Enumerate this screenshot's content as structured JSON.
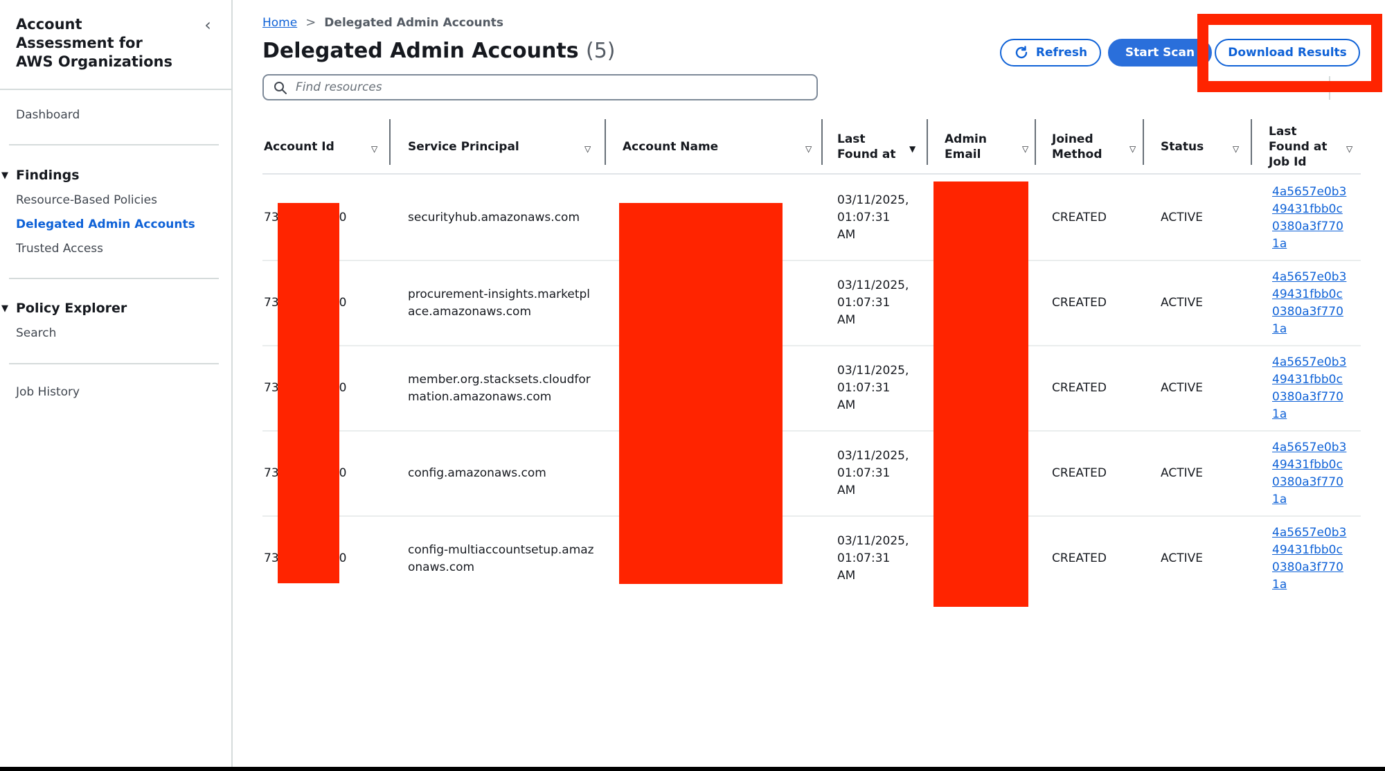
{
  "sidebar": {
    "title": "Account Assessment for AWS Organizations",
    "collapse_icon": "chevron-left-icon",
    "dashboard": "Dashboard",
    "sections": [
      {
        "label": "Findings",
        "expanded": true,
        "items": [
          {
            "label": "Resource-Based Policies",
            "active": false
          },
          {
            "label": "Delegated Admin Accounts",
            "active": true
          },
          {
            "label": "Trusted Access",
            "active": false
          }
        ]
      },
      {
        "label": "Policy Explorer",
        "expanded": true,
        "items": [
          {
            "label": "Search",
            "active": false
          }
        ]
      }
    ],
    "job_history": "Job History"
  },
  "breadcrumb": {
    "home": "Home",
    "separator": ">",
    "current": "Delegated Admin Accounts"
  },
  "header": {
    "title": "Delegated Admin Accounts",
    "count": "(5)"
  },
  "search": {
    "placeholder": "Find resources",
    "value": ""
  },
  "actions": {
    "refresh": "Refresh",
    "start_scan": "Start Scan",
    "download_results": "Download Results"
  },
  "colors": {
    "accent": "#0f62d7",
    "primary_button": "#2a6fdb",
    "redaction": "#ff2400",
    "highlight_box": "#ff2400"
  },
  "table": {
    "columns": [
      {
        "label": "Account Id",
        "sort": "none"
      },
      {
        "label": "Service Principal",
        "sort": "none"
      },
      {
        "label": "Account Name",
        "sort": "none"
      },
      {
        "label": "Last Found at",
        "sort": "active"
      },
      {
        "label": "Admin Email",
        "sort": "none"
      },
      {
        "label": "Joined Method",
        "sort": "none"
      },
      {
        "label": "Status",
        "sort": "none"
      },
      {
        "label": "Last Found at Job Id",
        "sort": "none"
      }
    ],
    "rows": [
      {
        "account_id_prefix": "73",
        "account_id_suffix": "0",
        "account_id_redacted": true,
        "service_principal": "securityhub.amazonaws.com",
        "account_name": "[redacted]",
        "last_found_at": "03/11/2025, 01:07:31 AM",
        "admin_email": "[redacted]",
        "joined_method": "CREATED",
        "status": "ACTIVE",
        "job_id": "4a5657e0b349431fbb0c0380a3f7701a"
      },
      {
        "account_id_prefix": "73",
        "account_id_suffix": "0",
        "account_id_redacted": true,
        "service_principal": "procurement-insights.marketplace.amazonaws.com",
        "account_name": "[redacted]",
        "last_found_at": "03/11/2025, 01:07:31 AM",
        "admin_email": "[redacted]",
        "joined_method": "CREATED",
        "status": "ACTIVE",
        "job_id": "4a5657e0b349431fbb0c0380a3f7701a"
      },
      {
        "account_id_prefix": "73",
        "account_id_suffix": "0",
        "account_id_redacted": true,
        "service_principal": "member.org.stacksets.cloudformation.amazonaws.com",
        "account_name": "[redacted]",
        "last_found_at": "03/11/2025, 01:07:31 AM",
        "admin_email": "[redacted]",
        "joined_method": "CREATED",
        "status": "ACTIVE",
        "job_id": "4a5657e0b349431fbb0c0380a3f7701a"
      },
      {
        "account_id_prefix": "73",
        "account_id_suffix": "0",
        "account_id_redacted": true,
        "service_principal": "config.amazonaws.com",
        "account_name": "[redacted]",
        "last_found_at": "03/11/2025, 01:07:31 AM",
        "admin_email": "[redacted]",
        "joined_method": "CREATED",
        "status": "ACTIVE",
        "job_id": "4a5657e0b349431fbb0c0380a3f7701a"
      },
      {
        "account_id_prefix": "73",
        "account_id_suffix": "0",
        "account_id_redacted": true,
        "service_principal": "config-multiaccountsetup.amazonaws.com",
        "account_name": "[redacted]",
        "last_found_at": "03/11/2025, 01:07:31 AM",
        "admin_email": "[redacted]",
        "joined_method": "CREATED",
        "status": "ACTIVE",
        "job_id": "4a5657e0b349431fbb0c0380a3f7701a"
      }
    ]
  }
}
